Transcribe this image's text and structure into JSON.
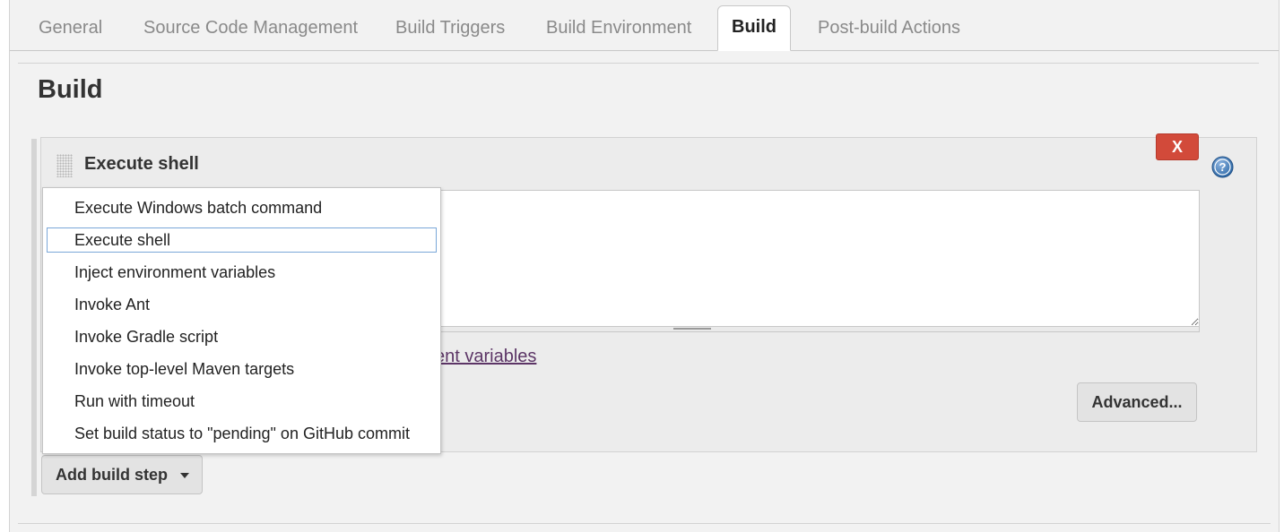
{
  "tabs": [
    {
      "label": "General",
      "active": false
    },
    {
      "label": "Source Code Management",
      "active": false
    },
    {
      "label": "Build Triggers",
      "active": false
    },
    {
      "label": "Build Environment",
      "active": false
    },
    {
      "label": "Build",
      "active": true
    },
    {
      "label": "Post-build Actions",
      "active": false
    }
  ],
  "section": {
    "title": "Build"
  },
  "build_step": {
    "title": "Execute shell",
    "delete_label": "X",
    "command": "",
    "env_link_visible": "ent variables",
    "advanced_label": "Advanced..."
  },
  "add_step": {
    "label": "Add build step",
    "caret_icon": "caret-down-icon",
    "menu_items": [
      {
        "label": "Execute Windows batch command",
        "selected": false
      },
      {
        "label": "Execute shell",
        "selected": true
      },
      {
        "label": "Inject environment variables",
        "selected": false
      },
      {
        "label": "Invoke Ant",
        "selected": false
      },
      {
        "label": "Invoke Gradle script",
        "selected": false
      },
      {
        "label": "Invoke top-level Maven targets",
        "selected": false
      },
      {
        "label": "Run with timeout",
        "selected": false
      },
      {
        "label": "Set build status to \"pending\" on GitHub commit",
        "selected": false
      }
    ]
  },
  "colors": {
    "delete_button": "#d24a3a",
    "help_icon": "#2f6aa8",
    "link": "#5c3566",
    "selection_border": "#7aa7d8"
  },
  "icons": {
    "help": "help-question-icon",
    "drag": "drag-handle-icon"
  }
}
